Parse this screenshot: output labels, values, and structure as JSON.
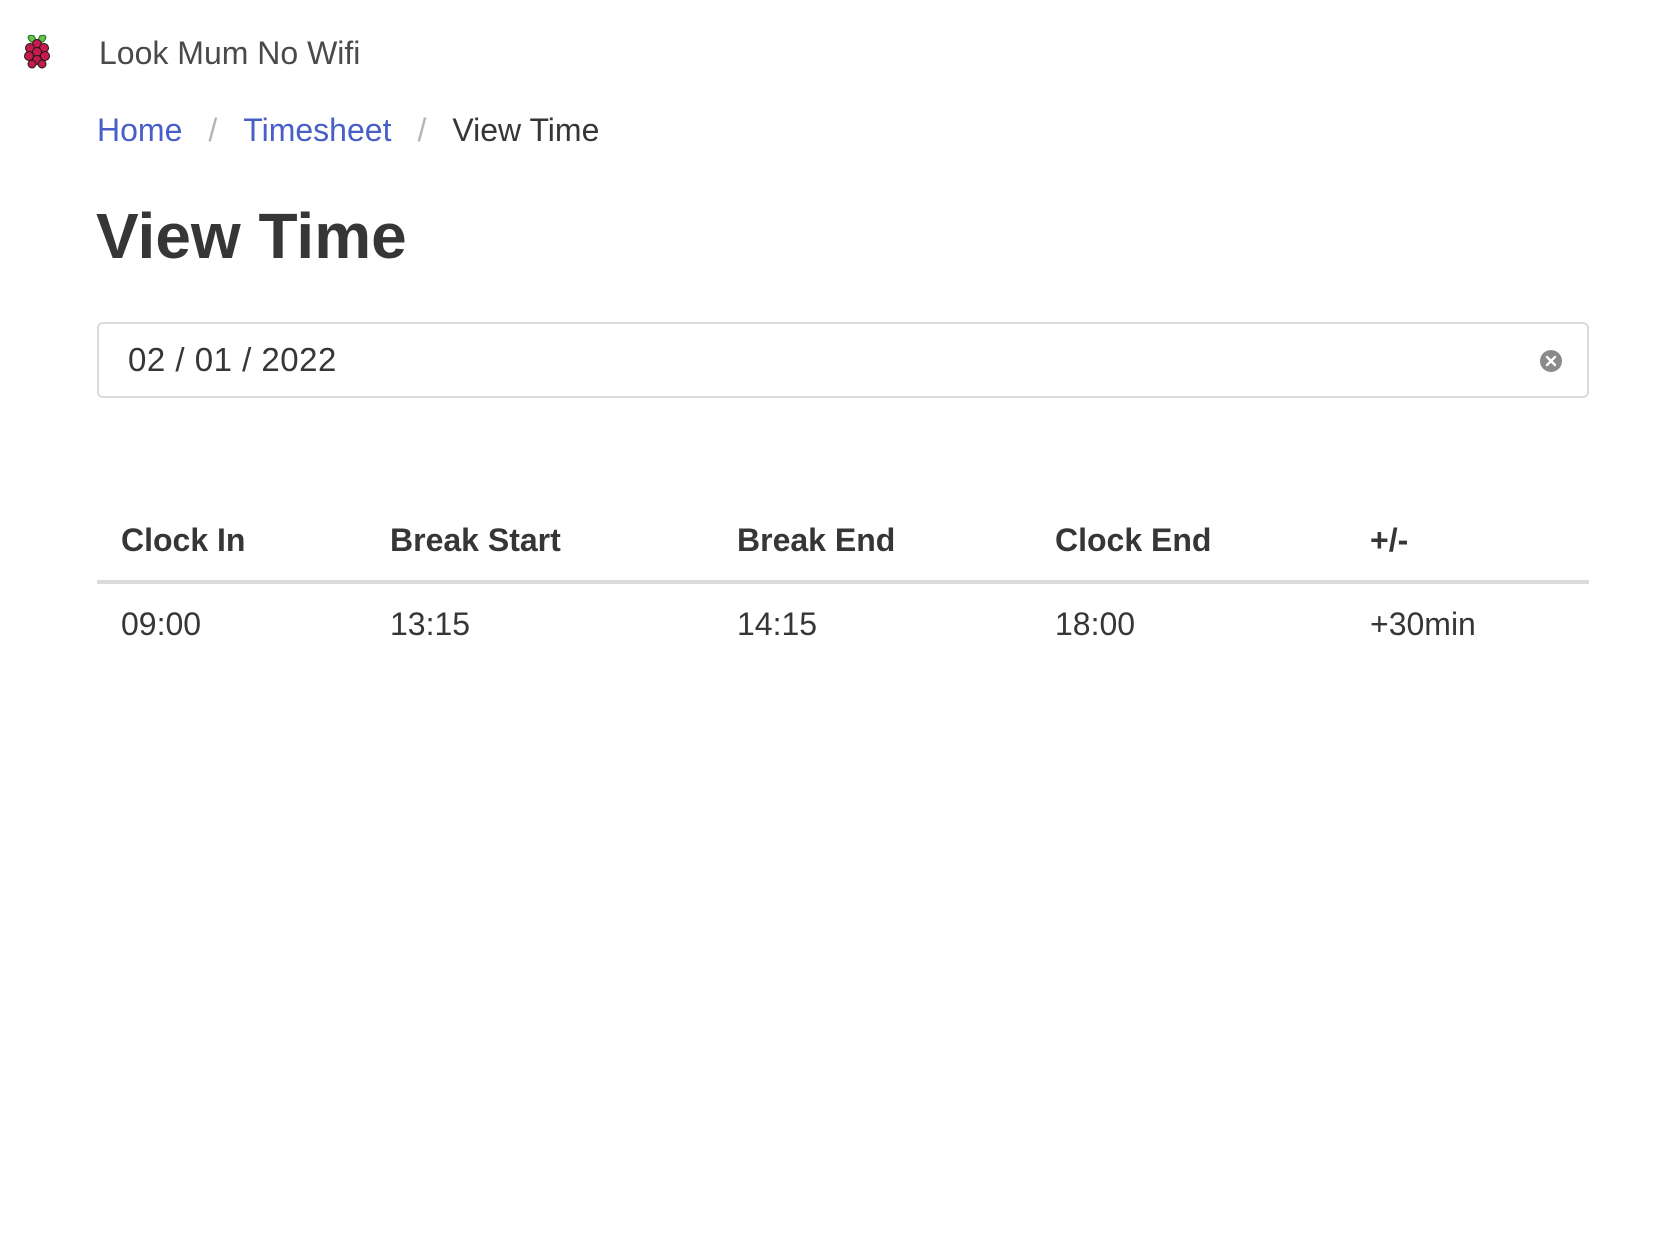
{
  "app": {
    "title": "Look Mum No Wifi",
    "logo_icon": "raspberry-pi-icon"
  },
  "breadcrumb": {
    "items": [
      {
        "label": "Home",
        "link": true
      },
      {
        "label": "Timesheet",
        "link": true
      },
      {
        "label": "View Time",
        "link": false
      }
    ],
    "separator": "/"
  },
  "page": {
    "title": "View Time"
  },
  "date_input": {
    "value": "02 / 01 / 2022",
    "clear_icon": "clear-circle-icon"
  },
  "table": {
    "headers": [
      "Clock In",
      "Break Start",
      "Break End",
      "Clock End",
      "+/-"
    ],
    "rows": [
      [
        "09:00",
        "13:15",
        "14:15",
        "18:00",
        "+30min"
      ]
    ]
  },
  "colors": {
    "link": "#485fc7",
    "text": "#363636",
    "border": "#dbdbdb",
    "separator": "#b5b5b5"
  }
}
